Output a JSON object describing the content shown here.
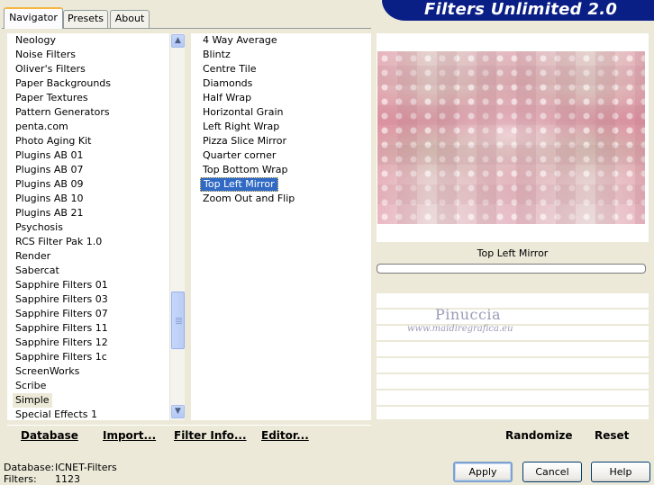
{
  "app": {
    "title": "Filters Unlimited 2.0"
  },
  "tabs": [
    {
      "label": "Navigator",
      "active": true
    },
    {
      "label": "Presets",
      "active": false
    },
    {
      "label": "About",
      "active": false
    }
  ],
  "categories": {
    "items": [
      "Neology",
      "Noise Filters",
      "Oliver's Filters",
      "Paper Backgrounds",
      "Paper Textures",
      "Pattern Generators",
      "penta.com",
      "Photo Aging Kit",
      "Plugins AB 01",
      "Plugins AB 07",
      "Plugins AB 09",
      "Plugins AB 10",
      "Plugins AB 21",
      "Psychosis",
      "RCS Filter Pak 1.0",
      "Render",
      "Sabercat",
      "Sapphire Filters 01",
      "Sapphire Filters 03",
      "Sapphire Filters 07",
      "Sapphire Filters 11",
      "Sapphire Filters 12",
      "Sapphire Filters 1c",
      "ScreenWorks",
      "Scribe",
      "Simple",
      "Special Effects 1"
    ],
    "highlighted_index": 25
  },
  "filters": {
    "items": [
      "4 Way Average",
      "Blintz",
      "Centre Tile",
      "Diamonds",
      "Half Wrap",
      "Horizontal Grain",
      "Left Right Wrap",
      "Pizza Slice Mirror",
      "Quarter corner",
      "Top Bottom Wrap",
      "Top Left Mirror",
      "Zoom Out and Flip"
    ],
    "selected_index": 10
  },
  "preview": {
    "filter_name": "Top Left Mirror"
  },
  "watermark": {
    "name": "Pinuccia",
    "url": "www.maidiregrafica.eu"
  },
  "toolbar": {
    "database": "Database",
    "import": "Import...",
    "filter_info": "Filter Info...",
    "editor": "Editor...",
    "randomize": "Randomize",
    "reset": "Reset"
  },
  "status": {
    "database_label": "Database:",
    "database_value": "ICNET-Filters",
    "filters_label": "Filters:",
    "filters_value": "1123"
  },
  "buttons": {
    "apply": "Apply",
    "cancel": "Cancel",
    "help": "Help"
  },
  "icons": {
    "scroll_up": "arrow-up-icon",
    "scroll_down": "arrow-down-icon",
    "grip": "scroll-grip-icon"
  }
}
